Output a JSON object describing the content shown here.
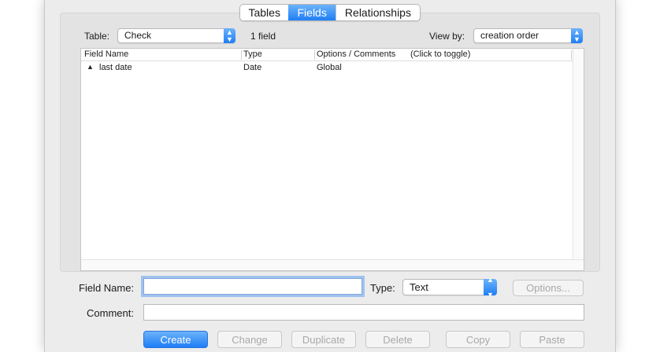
{
  "tabs": [
    {
      "label": "Tables",
      "active": false
    },
    {
      "label": "Fields",
      "active": true
    },
    {
      "label": "Relationships",
      "active": false
    }
  ],
  "table_selector": {
    "label": "Table:",
    "value": "Check"
  },
  "field_count": "1 field",
  "view_by": {
    "label": "View by:",
    "value": "creation order"
  },
  "columns": {
    "field_name": "Field Name",
    "type": "Type",
    "options": "Options / Comments",
    "toggle_hint": "(Click to toggle)"
  },
  "rows": [
    {
      "name": "last date",
      "type": "Date",
      "options": "Global"
    }
  ],
  "form": {
    "field_name_label": "Field Name:",
    "field_name_value": "",
    "type_label": "Type:",
    "type_value": "Text",
    "options_button": "Options...",
    "comment_label": "Comment:",
    "comment_value": ""
  },
  "buttons": {
    "create": "Create",
    "change": "Change",
    "duplicate": "Duplicate",
    "delete": "Delete",
    "copy": "Copy",
    "paste": "Paste"
  },
  "colors": {
    "accent": "#1f7ef5",
    "window_bg": "#ececec"
  }
}
